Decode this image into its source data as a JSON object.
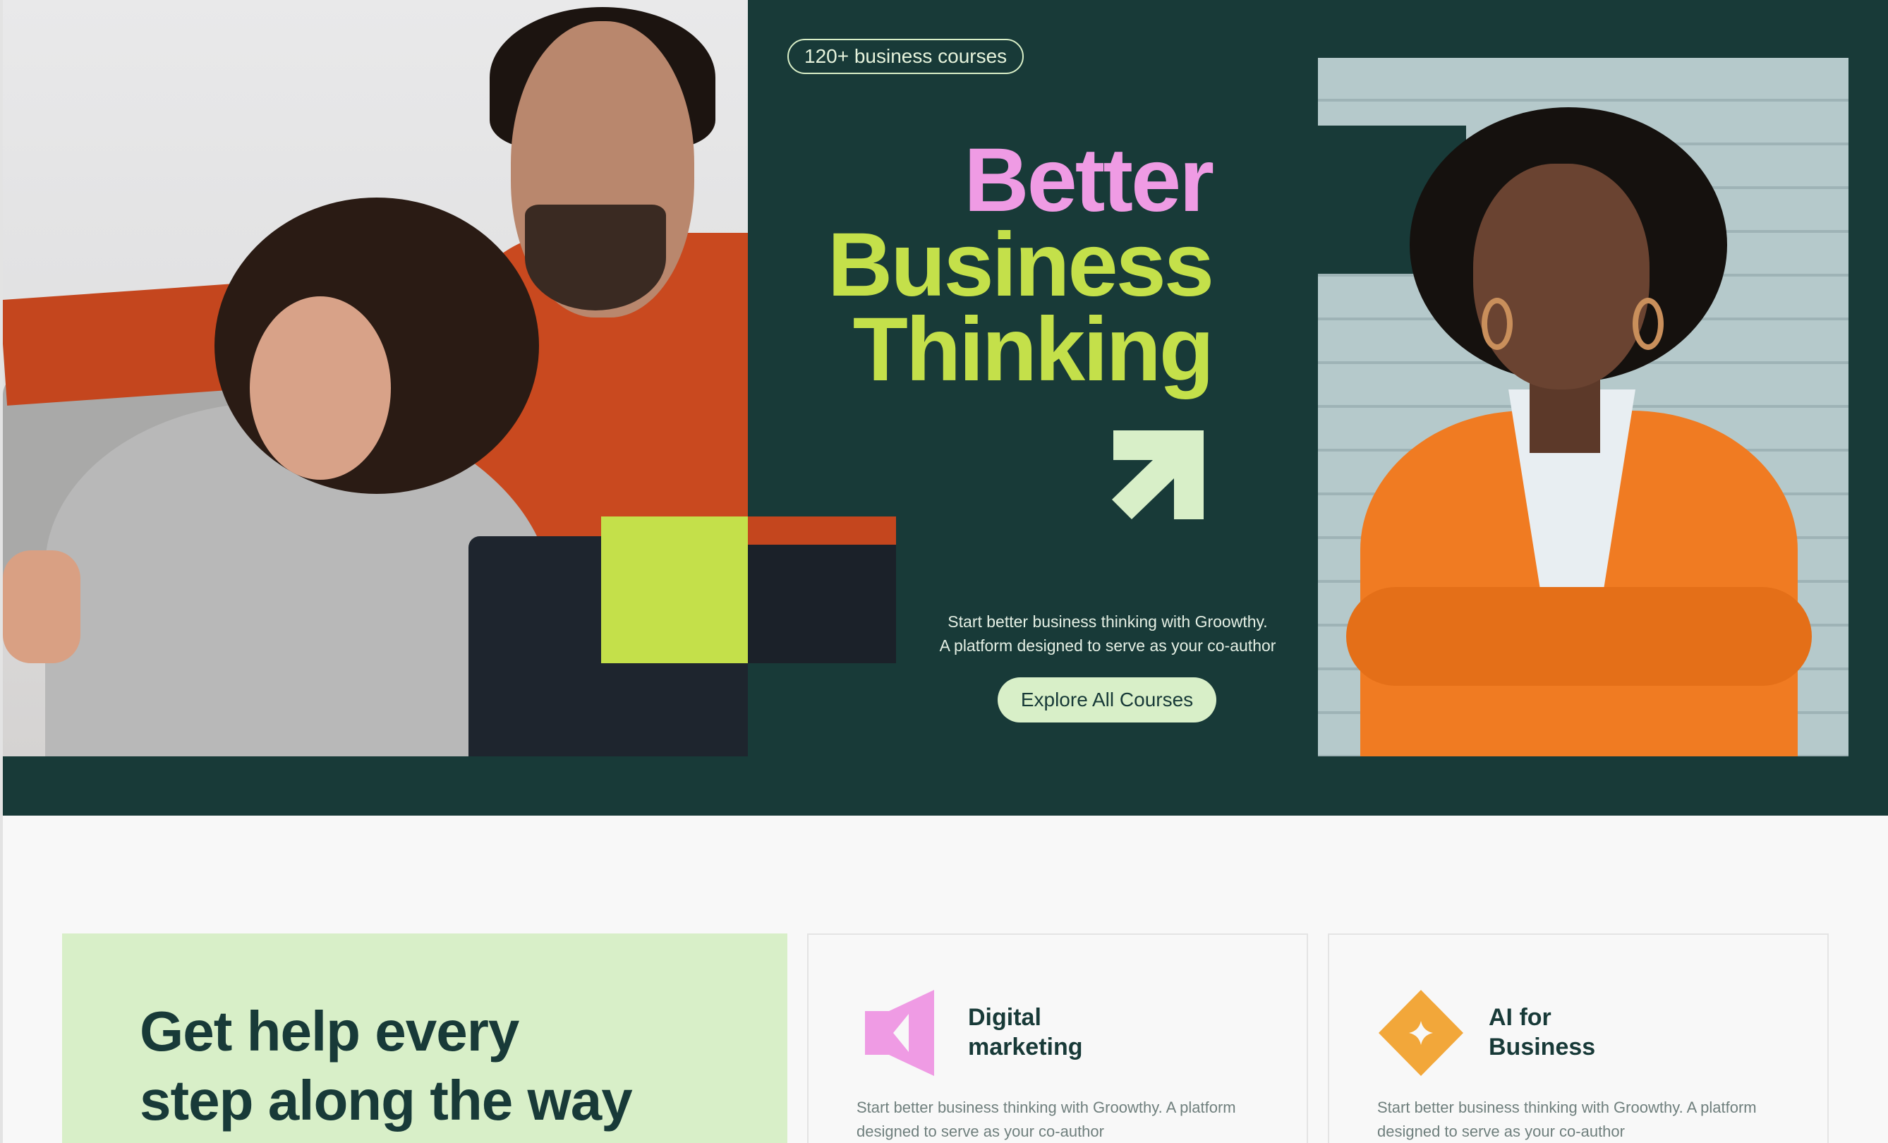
{
  "hero": {
    "badge": "120+ business courses",
    "headline_line1": "Better",
    "headline_line2": "Business",
    "headline_line3": "Thinking",
    "subtext_line1": "Start better business thinking with Groowthy.",
    "subtext_line2": "A platform designed to serve as your co-author",
    "cta_label": "Explore All Courses",
    "colors": {
      "background": "#183a38",
      "accent_pink": "#ef9be4",
      "accent_lime": "#c4e04a",
      "mint": "#d8efc8"
    }
  },
  "features": {
    "help_title_line1": "Get help every",
    "help_title_line2": "step along the way",
    "cards": [
      {
        "icon": "megaphone-icon",
        "title_line1": "Digital",
        "title_line2": "marketing",
        "desc_line1": "Start better business thinking with Groowthy.  A platform",
        "desc_line2": "designed to serve as your co-author",
        "color": "#ef9be4"
      },
      {
        "icon": "sparkle-diamond-icon",
        "title_line1": "AI for",
        "title_line2": "Business",
        "desc_line1": "Start better business thinking with Groowthy.  A platform",
        "desc_line2": "designed to serve as your co-author",
        "color": "#f2a73a"
      }
    ]
  }
}
